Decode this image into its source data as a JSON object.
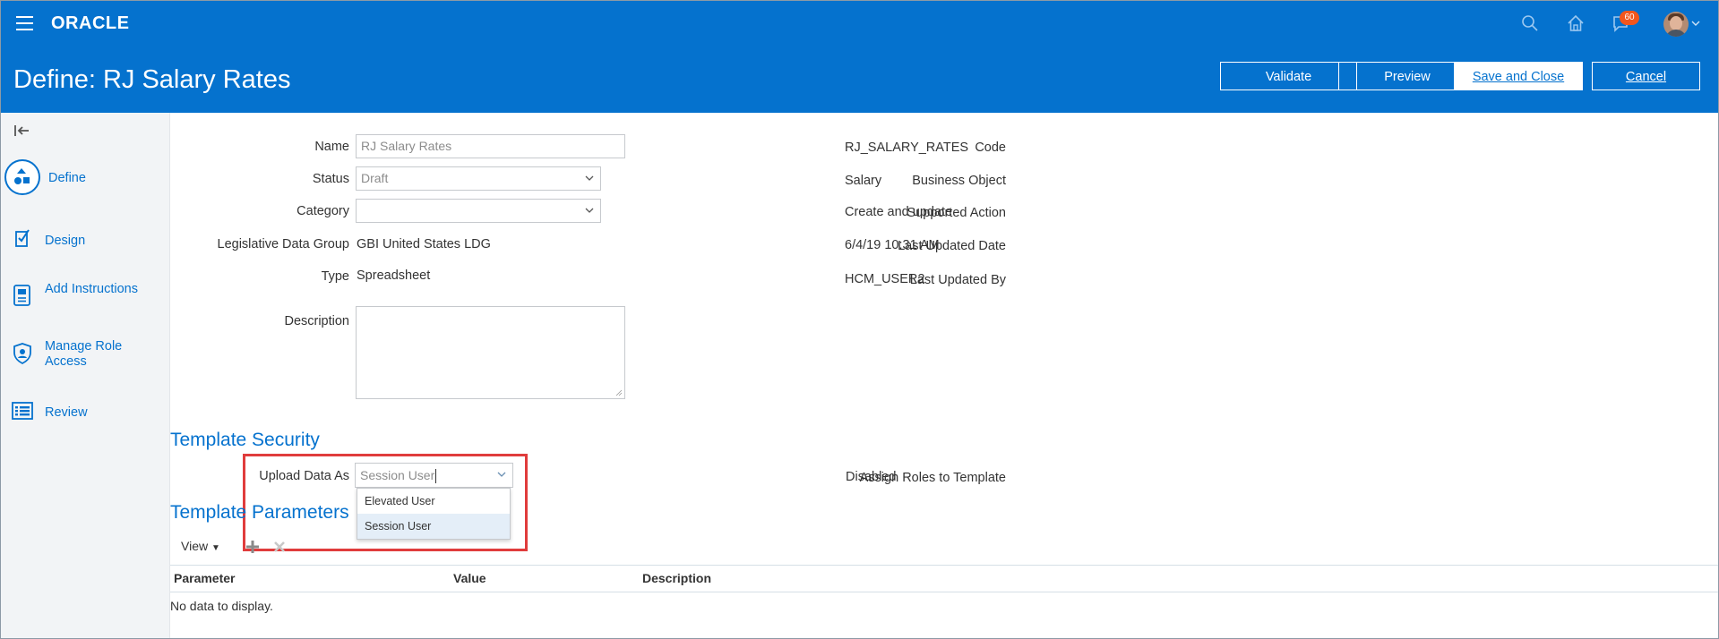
{
  "header": {
    "logo": "ORACLE",
    "notification_count": "60"
  },
  "title_bar": {
    "title": "Define: RJ Salary Rates",
    "buttons": {
      "validate": "Validate",
      "preview": "Preview",
      "save_close": "Save and Close",
      "cancel": "Cancel"
    }
  },
  "nav": {
    "items": [
      {
        "label": "Define",
        "icon": "define-icon"
      },
      {
        "label": "Design",
        "icon": "design-icon"
      },
      {
        "label": "Add Instructions",
        "icon": "instructions-icon"
      },
      {
        "label": "Manage Role Access",
        "icon": "shield-icon"
      },
      {
        "label": "Review",
        "icon": "review-list-icon"
      }
    ]
  },
  "form": {
    "name_label": "Name",
    "name_value": "RJ Salary Rates",
    "status_label": "Status",
    "status_value": "Draft",
    "category_label": "Category",
    "category_value": "",
    "ldg_label": "Legislative Data Group",
    "ldg_value": "GBI United States LDG",
    "type_label": "Type",
    "type_value": "Spreadsheet",
    "description_label": "Description",
    "description_value": "",
    "code_label": "Code",
    "code_value": "RJ_SALARY_RATES",
    "business_object_label": "Business Object",
    "business_object_value": "Salary",
    "supported_action_label": "Supported Action",
    "supported_action_value": "Create and update",
    "last_updated_date_label": "Last Updated Date",
    "last_updated_date_value": "6/4/19 10:31 AM",
    "last_updated_by_label": "Last Updated By",
    "last_updated_by_value": "HCM_USER2"
  },
  "security": {
    "title": "Template Security",
    "upload_label": "Upload Data As",
    "upload_value": "Session User",
    "options": [
      "Elevated User",
      "Session User"
    ],
    "selected_option": "Session User",
    "assign_roles_label": "Assign Roles to Template",
    "assign_roles_value": "Disabled"
  },
  "parameters": {
    "title": "Template Parameters",
    "view_label": "View",
    "columns": [
      "Parameter",
      "Value",
      "Description"
    ],
    "empty_text": "No data to display."
  },
  "colors": {
    "brand_blue": "#0572ce",
    "highlight_red": "#e03c3c",
    "badge_orange": "#f2561d"
  }
}
